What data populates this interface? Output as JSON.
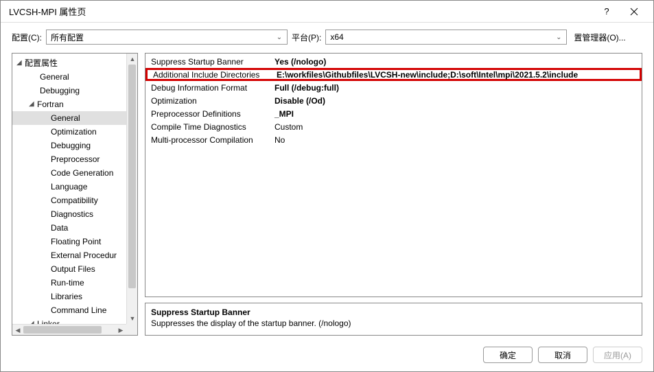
{
  "window": {
    "title": "LVCSH-MPI 属性页"
  },
  "topbar": {
    "config_label": "配置(C):",
    "config_value": "所有配置",
    "platform_label": "平台(P):",
    "platform_value": "x64",
    "manager_button": "置管理器(O)..."
  },
  "tree": {
    "root": "配置属性",
    "items": [
      "General",
      "Debugging"
    ],
    "fortran": "Fortran",
    "fortran_items": [
      "General",
      "Optimization",
      "Debugging",
      "Preprocessor",
      "Code Generation",
      "Language",
      "Compatibility",
      "Diagnostics",
      "Data",
      "Floating Point",
      "External Procedur",
      "Output Files",
      "Run-time",
      "Libraries",
      "Command Line"
    ],
    "linker": "Linker"
  },
  "grid": [
    {
      "key": "Suppress Startup Banner",
      "val": "Yes (/nologo)",
      "bold": true
    },
    {
      "key": "Additional Include Directories",
      "val": "E:\\workfiles\\Githubfiles\\LVCSH-new\\include;D:\\soft\\Intel\\mpi\\2021.5.2\\include",
      "bold": true,
      "highlight": true
    },
    {
      "key": "Debug Information Format",
      "val": "Full (/debug:full)",
      "bold": true
    },
    {
      "key": "Optimization",
      "val": "Disable (/Od)",
      "bold": true
    },
    {
      "key": "Preprocessor Definitions",
      "val": "_MPI",
      "bold": true
    },
    {
      "key": "Compile Time Diagnostics",
      "val": "Custom",
      "bold": false
    },
    {
      "key": "Multi-processor Compilation",
      "val": "No",
      "bold": false
    }
  ],
  "description": {
    "title": "Suppress Startup Banner",
    "text": "Suppresses the display of the startup banner. (/nologo)"
  },
  "footer": {
    "ok": "确定",
    "cancel": "取消",
    "apply": "应用(A)"
  }
}
